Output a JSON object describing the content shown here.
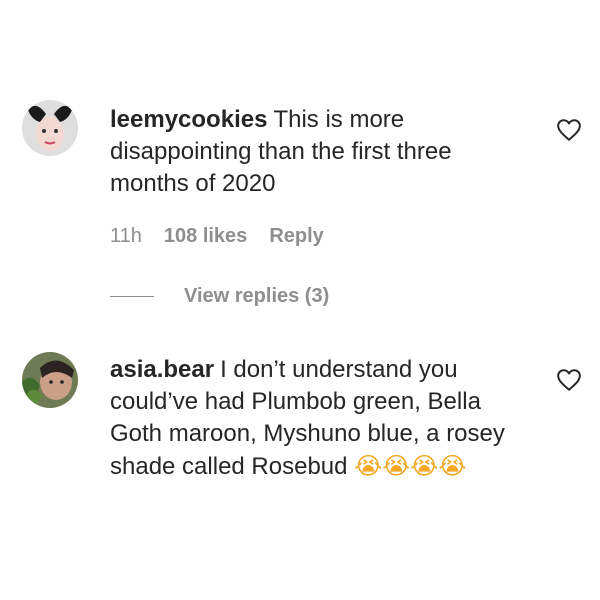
{
  "comments": [
    {
      "username": "leemycookies",
      "text": "This is more disappointing than the first three months of 2020",
      "meta": {
        "time": "11h",
        "likes": "108 likes",
        "reply": "Reply"
      },
      "view_replies": "View replies (3)",
      "like_icon": "heart-outline-icon"
    },
    {
      "username": "asia.bear",
      "text": "I don’t understand you could’ve had Plumbob green, Bella Goth maroon, Myshuno blue, a rosey shade called Rosebud",
      "emoji": "😭😭😭😭",
      "like_icon": "heart-outline-icon"
    }
  ]
}
